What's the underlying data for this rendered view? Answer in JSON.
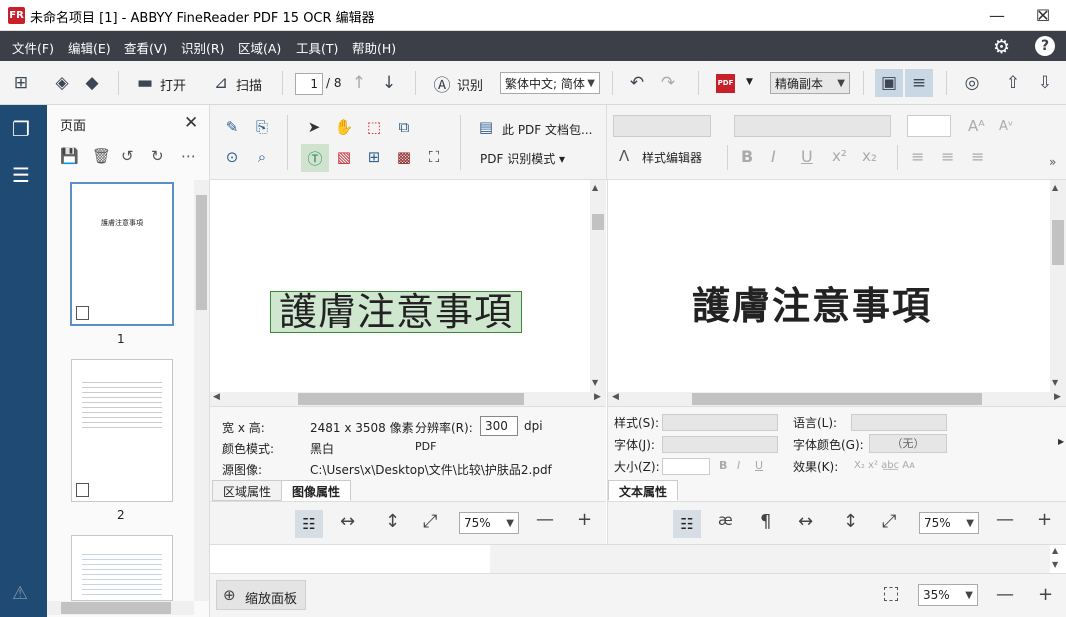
{
  "window": {
    "title": "未命名项目 [1] - ABBYY FineReader PDF 15 OCR 编辑器",
    "logo": "FR",
    "minimize": "—",
    "maximize": "☐",
    "close": "✕"
  },
  "menu": [
    "文件(F)",
    "编辑(E)",
    "查看(V)",
    "识别(R)",
    "区域(A)",
    "工具(T)",
    "帮助(H)"
  ],
  "toolbar": {
    "open_label": "打开",
    "scan_label": "扫描",
    "page_number": "1",
    "page_total": "/ 8",
    "recognize_label": "识别",
    "language_value": "繁体中文; 简体",
    "pdf_badge": "PDF",
    "output_value": "精确副本"
  },
  "pages_panel": {
    "title": "页面",
    "pages": [
      {
        "number": "1",
        "thumb_text": "護膚注意事項"
      },
      {
        "number": "2",
        "thumb_text": ""
      },
      {
        "number": "",
        "thumb_text": ""
      }
    ]
  },
  "image_tools": {
    "pdf_pack_label": "此 PDF 文档包...",
    "pdf_mode_label": "PDF 识别模式 ▾"
  },
  "text_tools": {
    "style_editor_label": "样式编辑器",
    "overflow": "»"
  },
  "image_view": {
    "content_text": "護膚注意事項"
  },
  "text_view": {
    "content_text": "護膚注意事項"
  },
  "image_props": {
    "size_label": "宽 x 高:",
    "size_value": "2481 x 3508 像素",
    "resolution_label": "分辨率(R):",
    "resolution_value": "300",
    "resolution_unit": "dpi",
    "color_label": "颜色模式:",
    "color_value": "黑白",
    "format_value": "PDF",
    "source_label": "源图像:",
    "source_value": "C:\\Users\\x\\Desktop\\文件\\比较\\护肤品2.pdf",
    "tabs": [
      "区域属性",
      "图像属性"
    ],
    "active_tab": 1
  },
  "text_props": {
    "style_label": "样式(S):",
    "language_label": "语言(L):",
    "font_label": "字体(J):",
    "font_color_label": "字体颜色(G):",
    "font_color_value": "（无）",
    "size_label": "大小(Z):",
    "effects_label": "效果(K):",
    "effects": "X₂  x²  a͟b͟c  Aᴀ",
    "tabs": [
      "文本属性"
    ]
  },
  "zoom": {
    "left_zoom": "75%",
    "right_zoom": "75%",
    "status_zoom": "35%",
    "zoom_panel_label": "缩放面板"
  }
}
